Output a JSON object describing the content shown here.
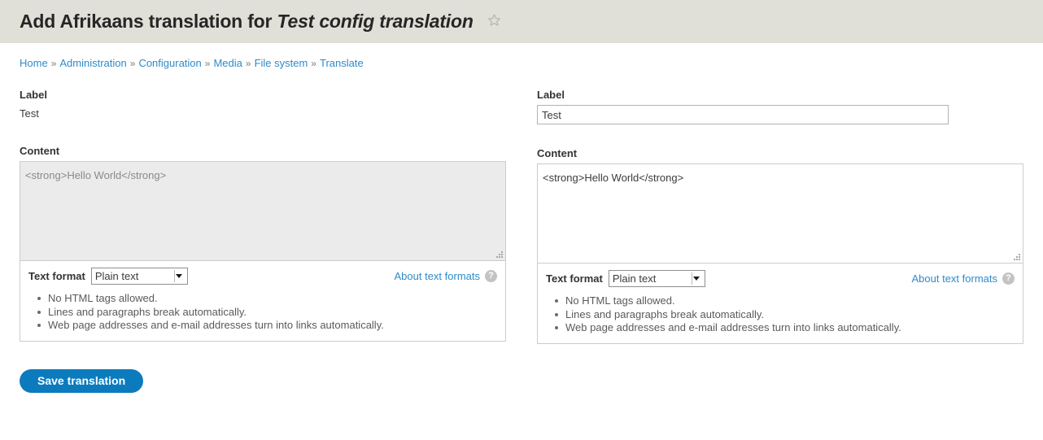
{
  "header": {
    "title_prefix": "Add Afrikaans translation for ",
    "title_emphasis": "Test config translation",
    "star_icon": "star-outline-icon",
    "background_color": "#e0e0d8"
  },
  "breadcrumb": {
    "separator": "»",
    "items": [
      {
        "label": "Home"
      },
      {
        "label": "Administration"
      },
      {
        "label": "Configuration"
      },
      {
        "label": "Media"
      },
      {
        "label": "File system"
      },
      {
        "label": "Translate"
      }
    ],
    "link_color": "#2e8bc9"
  },
  "columns": {
    "source": {
      "label_field": {
        "label": "Label",
        "value": "Test",
        "readonly": true
      },
      "content_field": {
        "label": "Content",
        "value": "<strong>Hello World</strong>",
        "readonly": true
      },
      "filter": {
        "format_label": "Text format",
        "selected_format": "Plain text",
        "options": [
          "Plain text"
        ],
        "about_link": "About text formats",
        "help_icon": "help-question-icon",
        "tips": [
          "No HTML tags allowed.",
          "Lines and paragraphs break automatically.",
          "Web page addresses and e-mail addresses turn into links automatically."
        ]
      }
    },
    "translation": {
      "label_field": {
        "label": "Label",
        "value": "Test",
        "readonly": false
      },
      "content_field": {
        "label": "Content",
        "value": "<strong>Hello World</strong>",
        "readonly": false
      },
      "filter": {
        "format_label": "Text format",
        "selected_format": "Plain text",
        "options": [
          "Plain text"
        ],
        "about_link": "About text formats",
        "help_icon": "help-question-icon",
        "tips": [
          "No HTML tags allowed.",
          "Lines and paragraphs break automatically.",
          "Web page addresses and e-mail addresses turn into links automatically."
        ]
      }
    }
  },
  "actions": {
    "save_label": "Save translation",
    "primary_color": "#0c7bbd"
  }
}
